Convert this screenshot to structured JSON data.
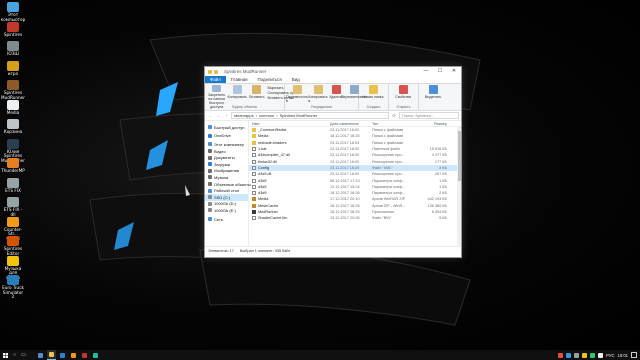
{
  "desktop": {
    "icons": [
      {
        "label": "Этот\nкомпьютер",
        "color": "#4aa3df"
      },
      {
        "label": "Spintires",
        "color": "#c0392b"
      },
      {
        "label": "ЮЗШ",
        "color": "#7f8c8d"
      },
      {
        "label": "игра",
        "color": "#d4a017"
      },
      {
        "label": "Spintires\nMudRunner",
        "color": "#8e5a2a"
      },
      {
        "label": "Media",
        "color": "#ecf0f1"
      },
      {
        "label": "Корзина",
        "color": "#bdc3c7"
      },
      {
        "label": "Юлия\nSpintires\nMudRunner",
        "color": "#2c3e50"
      },
      {
        "label": "ThunderMP",
        "color": "#e67e22"
      },
      {
        "label": "ETS FIX",
        "color": "#95a5a6"
      },
      {
        "label": "ETS FIX - dll",
        "color": "#95a5a6"
      },
      {
        "label": "Counter-Str...\nGlobal Offe...",
        "color": "#f39c12"
      },
      {
        "label": "Spintires\nEditor",
        "color": "#d35400"
      },
      {
        "label": "Музыка для\nютуба",
        "color": "#f1c40f"
      },
      {
        "label": "Euro Truck\nSimulator 2",
        "color": "#2980b9"
      }
    ]
  },
  "window": {
    "title": "Spintires MudRunner",
    "tabs": [
      "Файл",
      "Главная",
      "Поделиться",
      "Вид"
    ],
    "ribbon": {
      "pin_label": "Закрепить на панели быстрого доступа",
      "copy_label": "Копировать",
      "paste_label": "Вставить",
      "small_items": [
        "Вырезать",
        "Скопировать путь",
        "Вставить ярлык"
      ],
      "clipboard_group": "Буфер обмена",
      "move_label": "Переместить в",
      "copyto_label": "Копировать в",
      "delete_label": "Удалить",
      "rename_label": "Переименовать",
      "organize_group": "Упорядочить",
      "newfolder_label": "Новая папка",
      "create_group": "Создать",
      "properties_label": "Свойства",
      "open_group": "Открыть",
      "select_label": "Выделить"
    },
    "address": {
      "path": [
        "steamapps",
        "common",
        "Spintires MudRunner"
      ],
      "search_placeholder": "Поиск: Spintires..."
    },
    "nav": [
      {
        "label": "Быстрый доступ",
        "color": "#4a90d9",
        "sel": false
      },
      {
        "label": "OneDrive",
        "color": "#2e7fd1",
        "sel": false
      },
      {
        "label": "Этот компьютер",
        "color": "#4a90d9",
        "sel": false
      },
      {
        "label": "Видео",
        "color": "#6d6d6d",
        "sel": false
      },
      {
        "label": "Документы",
        "color": "#6d6d6d",
        "sel": false
      },
      {
        "label": "Загрузки",
        "color": "#2e7fd1",
        "sel": false
      },
      {
        "label": "Изображения",
        "color": "#6d6d6d",
        "sel": false
      },
      {
        "label": "Музыка",
        "color": "#6d6d6d",
        "sel": false
      },
      {
        "label": "Объемные объекты",
        "color": "#6d6d6d",
        "sel": false
      },
      {
        "label": "Рабочий стол",
        "color": "#4a90d9",
        "sel": false
      },
      {
        "label": "SSD (C:)",
        "color": "#8a8a8a",
        "sel": true
      },
      {
        "label": "1000Gb (D:)",
        "color": "#8a8a8a",
        "sel": false
      },
      {
        "label": "1000Gb (E:)",
        "color": "#8a8a8a",
        "sel": false
      },
      {
        "label": "Сеть",
        "color": "#4a90d9",
        "sel": false
      }
    ],
    "columns": {
      "name": "Имя",
      "date": "Дата изменения",
      "type": "Тип",
      "size": "Размер"
    },
    "files": [
      {
        "name": "_CommonRedist",
        "date": "23.11.2017 16:02",
        "type": "Папка с файлами",
        "size": "",
        "icon": "folder",
        "sel": false
      },
      {
        "name": "Media",
        "date": "18.12.2017 18:26",
        "type": "Папка с файлами",
        "size": "",
        "icon": "folder",
        "sel": false
      },
      {
        "name": "reshade-shaders",
        "date": "23.11.2017 16:03",
        "type": "Папка с файлами",
        "size": "",
        "icon": "folder",
        "sel": false
      },
      {
        "name": "1.bat",
        "date": "23.11.2017 16:00",
        "type": "Пакетный файл",
        "size": "15 516 КБ",
        "icon": "file",
        "sel": false
      },
      {
        "name": "d3dcompiler_47.dll",
        "date": "23.11.2017 16:00",
        "type": "Расширение при...",
        "size": "4 077 КБ",
        "icon": "file",
        "sel": false
      },
      {
        "name": "binkw32.dll",
        "date": "23.11.2017 16:00",
        "type": "Расширение при...",
        "size": "177 КБ",
        "icon": "file",
        "sel": false
      },
      {
        "name": "Config",
        "date": "23.11.2017 16:20",
        "type": "Файл \"XML\"",
        "size": "3 КБ",
        "icon": "cfg",
        "sel": true
      },
      {
        "name": "d3d9.dll",
        "date": "23.11.2017 16:00",
        "type": "Расширение при...",
        "size": "267 КБ",
        "icon": "file",
        "sel": false
      },
      {
        "name": "d3d9",
        "date": "08.12.2017 17:23",
        "type": "Параметры конф...",
        "size": "1 КБ",
        "icon": "file",
        "sel": false
      },
      {
        "name": "d3d9",
        "date": "12.12.2017 15:04",
        "type": "Параметры конф...",
        "size": "1 КБ",
        "icon": "file",
        "sel": false
      },
      {
        "name": "d3d9",
        "date": "18.12.2017 18:26",
        "type": "Параметры конф...",
        "size": "2 КБ",
        "icon": "file",
        "sel": false
      },
      {
        "name": "Media",
        "date": "17.12.2017 20:10",
        "type": "Архив WinRAR ZIP",
        "size": "442 193 КБ",
        "icon": "zip",
        "sel": false
      },
      {
        "name": "MeshCache",
        "date": "18.12.2017 18:26",
        "type": "Архив ZIP - WinR...",
        "size": "136 380 КБ",
        "icon": "zip",
        "sel": false
      },
      {
        "name": "MudRunner",
        "date": "18.12.2017 18:25",
        "type": "Приложение",
        "size": "6 554 КБ",
        "icon": "exe",
        "sel": false
      },
      {
        "name": "ShaderCache.bin",
        "date": "13.12.2017 20:05",
        "type": "Файл \"BIN\"",
        "size": "5 КБ",
        "icon": "file",
        "sel": false
      }
    ],
    "status": {
      "count": "Элементов: 17",
      "selected": "Выбран 1 элемент: 335 байт"
    }
  },
  "taskbar": {
    "apps": [
      {
        "color": "#4a90d9",
        "active": false
      },
      {
        "color": "#e8c24e",
        "active": true
      },
      {
        "color": "#2e7fd1",
        "active": false
      },
      {
        "color": "#f39c12",
        "active": false
      },
      {
        "color": "#c0392b",
        "active": false
      },
      {
        "color": "#1abc9c",
        "active": false
      }
    ],
    "tray_icons": [
      "#e74c3c",
      "#3498db",
      "#95a5a6",
      "#f1c40f",
      "#2ecc71",
      "#ecf0f1"
    ],
    "lang": "РУС",
    "time": "18:01"
  }
}
